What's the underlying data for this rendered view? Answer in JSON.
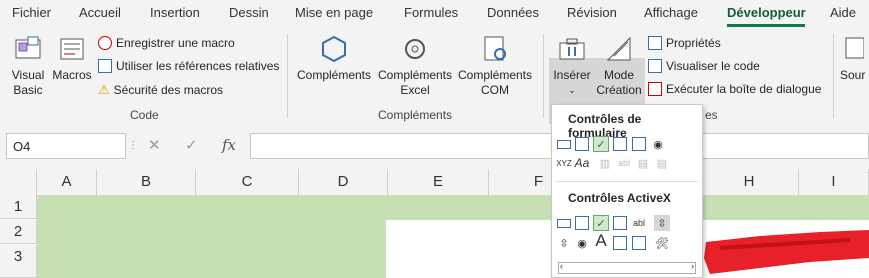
{
  "menu": {
    "tabs": [
      "Fichier",
      "Accueil",
      "Insertion",
      "Dessin",
      "Mise en page",
      "Formules",
      "Données",
      "Révision",
      "Affichage",
      "Développeur",
      "Aide"
    ],
    "active_tab": "Développeur"
  },
  "ribbon": {
    "code": {
      "group_label": "Code",
      "visual_basic": "Visual Basic",
      "macros": "Macros",
      "record_macro": "Enregistrer une macro",
      "relative_refs": "Utiliser les références relatives",
      "macro_security": "Sécurité des macros"
    },
    "addins": {
      "group_label": "Compléments",
      "complements": "Compléments",
      "excel_complements": "Compléments Excel",
      "com_complements": "Compléments COM"
    },
    "controls": {
      "insert": "Insérer",
      "design_mode": "Mode Création",
      "properties": "Propriétés",
      "view_code": "Visualiser le code",
      "run_dialog": "Exécuter la boîte de dialogue",
      "group_label_partial": "es"
    },
    "source_partial": "Sour"
  },
  "formula_bar": {
    "name_box": "O4",
    "fx": "fx"
  },
  "grid": {
    "columns": [
      "A",
      "B",
      "C",
      "D",
      "E",
      "F",
      "H",
      "I"
    ],
    "rows": [
      "1",
      "2",
      "3"
    ]
  },
  "insert_dropdown": {
    "form_controls_title": "Contrôles de formulaire",
    "activex_title": "Contrôles ActiveX"
  },
  "colors": {
    "accent": "#107c41",
    "cell_fill": "#c6e0b4",
    "scribble": "#e8202a"
  }
}
